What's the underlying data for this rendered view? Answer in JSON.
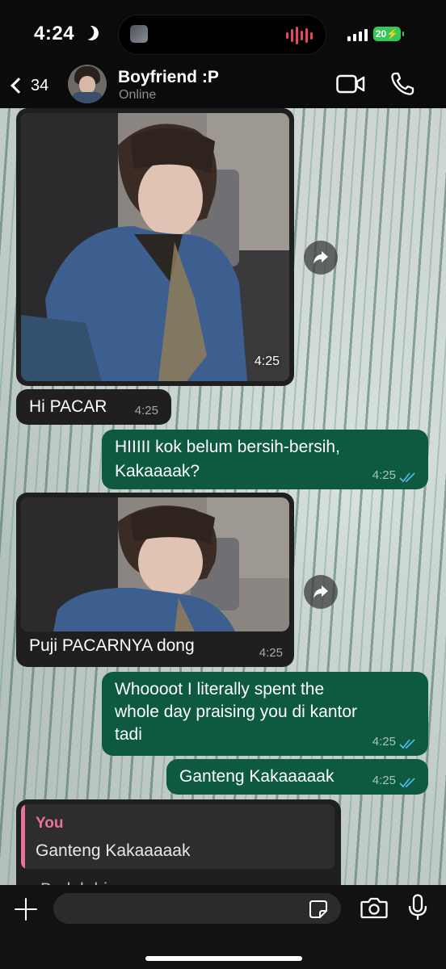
{
  "status_bar": {
    "time": "4:24",
    "battery": "20"
  },
  "header": {
    "unread_count": "34",
    "contact_name": "Boyfriend :P",
    "contact_status": "Online"
  },
  "messages": [
    {
      "type": "photo",
      "direction": "in",
      "time": "4:25"
    },
    {
      "type": "text",
      "direction": "in",
      "text": "Hi PACAR",
      "time": "4:25"
    },
    {
      "type": "text",
      "direction": "out",
      "line1": "HIIIII kok belum bersih-bersih,",
      "line2": "Kakaaaak?",
      "time": "4:25",
      "read": true
    },
    {
      "type": "photo",
      "direction": "in",
      "caption": "Puji PACARNYA dong",
      "time": "4:25"
    },
    {
      "type": "text",
      "direction": "out",
      "line1": "Whoooot I literally spent the",
      "line2": "whole day praising you di kantor",
      "line3": "tadi",
      "time": "4:25",
      "read": true
    },
    {
      "type": "text",
      "direction": "out",
      "text": "Ganteng Kakaaaaak",
      "time": "4:25",
      "read": true
    },
    {
      "type": "reply",
      "direction": "in",
      "quote_author": "You",
      "quote_text": "Ganteng Kakaaaaak",
      "text": "Bodoh bi... ...a ..."
    }
  ],
  "input": {
    "value": "",
    "placeholder": ""
  },
  "colors": {
    "incoming": "#1f1f1f",
    "outgoing": "#0d5a3e",
    "quote_accent": "#e8739a",
    "read_tick": "#4fb6ec"
  },
  "icons": [
    "back-chevron-icon",
    "video-call-icon",
    "voice-call-icon",
    "forward-icon",
    "plus-icon",
    "sticker-icon",
    "camera-icon",
    "mic-icon"
  ]
}
